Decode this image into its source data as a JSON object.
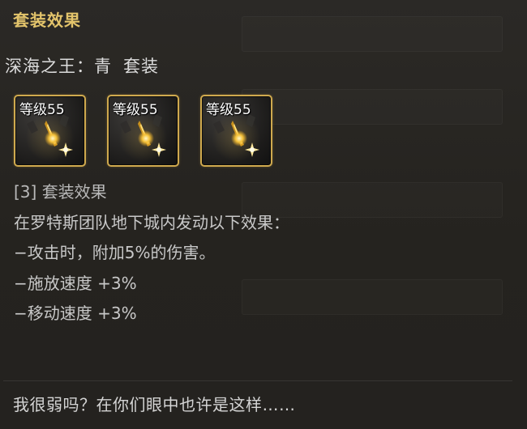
{
  "tooltip": {
    "header": "套装效果",
    "set_name": "深海之王：青",
    "set_suffix": "套装",
    "items": [
      {
        "level_label": "等级55",
        "icon": "golden-spark-icon"
      },
      {
        "level_label": "等级55",
        "icon": "golden-spark-icon"
      },
      {
        "level_label": "等级55",
        "icon": "golden-spark-icon"
      }
    ],
    "effect_title": "[3] 套装效果",
    "effect_lines": [
      "在罗特斯团队地下城内发动以下效果：",
      "−攻击时，附加5%的伤害。",
      "−施放速度 +3%",
      "−移动速度 +3%"
    ],
    "flavor_text": "我很弱吗？在你们眼中也许是这样……"
  },
  "colors": {
    "header": "#e3c46b",
    "item_border": "#cfa94e",
    "text": "#c8c8c8",
    "background": "#27251f"
  }
}
